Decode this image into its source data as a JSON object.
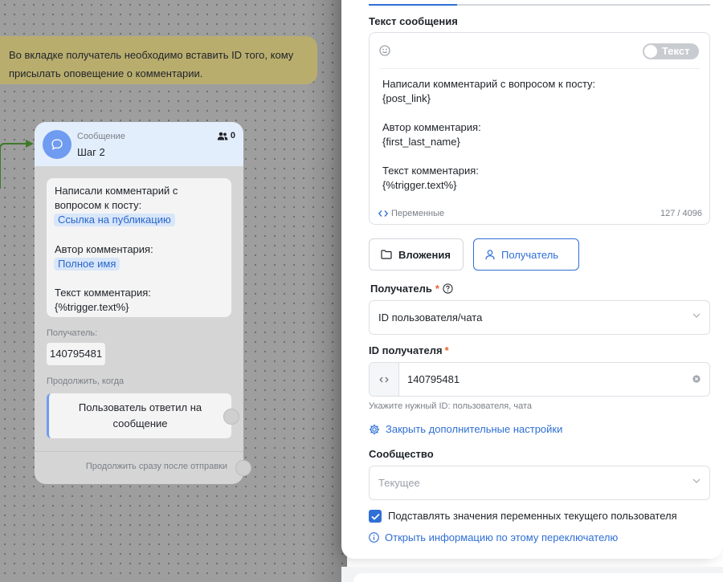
{
  "canvas": {
    "note_text": "Во вкладке получатель необходимо вставить ID того, кому присылать оповещение о комментарии.",
    "node": {
      "type": "Сообщение",
      "name": "Шаг 2",
      "users_count": "0",
      "message_lines": {
        "line1": "Написали комментарий с вопросом к посту:",
        "tag1": "Ссылка на публикацию",
        "line2": "Автор комментария:",
        "tag2": "Полное имя",
        "line3": "Текст комментария:",
        "line4": "{%trigger.text%}"
      },
      "recipient_label": "Получатель:",
      "recipient_value": "140795481",
      "continue_label": "Продолжить, когда",
      "condition": "Пользователь ответил на сообщение",
      "footer": "Продолжить сразу после отправки"
    }
  },
  "panel": {
    "message_section_title": "Текст сообщения",
    "editor": {
      "toggle_label": "Текст",
      "text": "Написали комментарий с вопросом к посту:\n{post_link}\n\nАвтор комментария:\n{first_last_name}\n\nТекст комментария:\n{%trigger.text%}",
      "variables_link": "Переменные",
      "counter": "127 / 4096"
    },
    "buttons": {
      "attachments": "Вложения",
      "recipient": "Получатель"
    },
    "recipient_field": {
      "label": "Получатель",
      "required": "*",
      "value": "ID пользователя/чата"
    },
    "recipient_id": {
      "label": "ID получателя",
      "required": "*",
      "value": "140795481",
      "hint": "Укажите нужный ID: пользователя, чата"
    },
    "close_settings_link": "Закрыть дополнительные настройки",
    "community": {
      "label": "Сообщество",
      "placeholder": "Текущее"
    },
    "substitute_checkbox_label": "Подставлять значения переменных текущего пользователя",
    "info_link": "Открыть информацию по этому переключателю",
    "colors": {
      "accent": "#2f6fd6",
      "note": "#b9ad6e",
      "node_header": "#e3eefc",
      "required": "#e8612c"
    }
  }
}
